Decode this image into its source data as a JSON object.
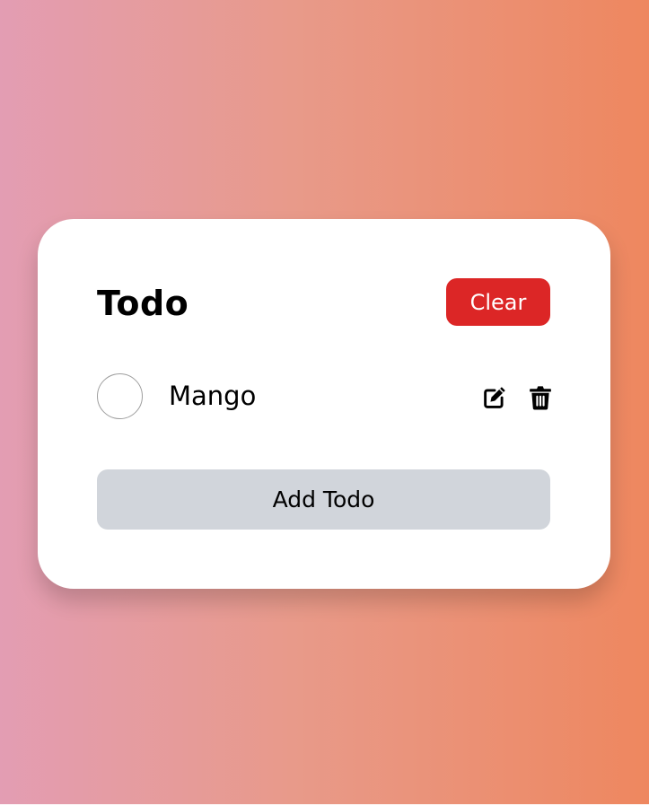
{
  "card": {
    "title": "Todo",
    "clear_label": "Clear"
  },
  "todos": [
    {
      "text": "Mango",
      "completed": false
    }
  ],
  "add_button_label": "Add Todo",
  "colors": {
    "clear_button": "#dc2626",
    "add_button": "#d1d5db",
    "gradient_start": "#e39db3",
    "gradient_end": "#ee875f"
  },
  "icons": {
    "edit": "edit-icon",
    "delete": "trash-icon"
  }
}
